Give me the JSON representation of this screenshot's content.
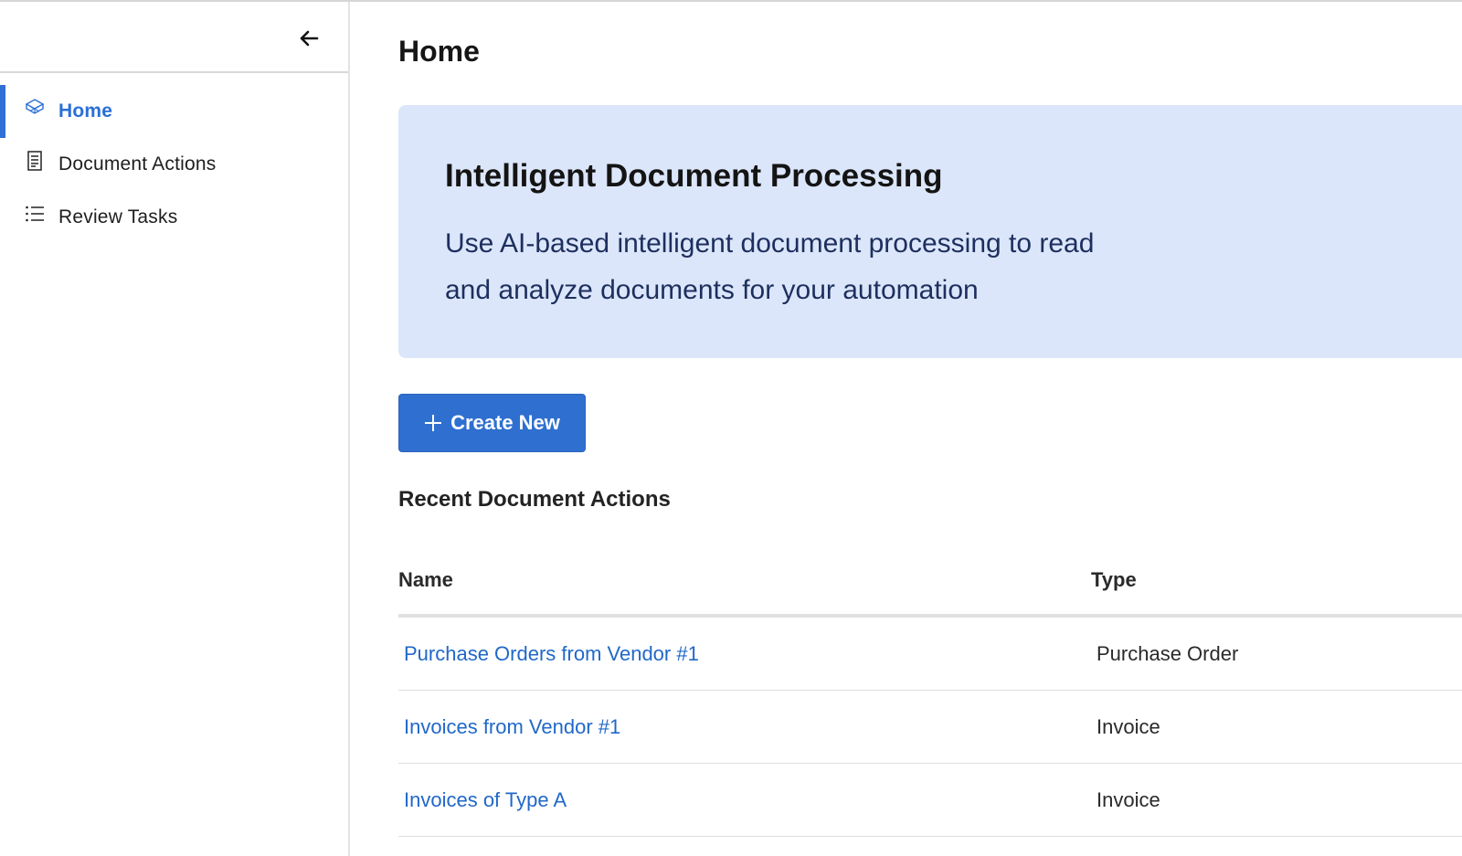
{
  "sidebar": {
    "collapse_icon": "arrow-left-icon",
    "items": [
      {
        "label": "Home",
        "icon": "home-cube-icon",
        "active": true
      },
      {
        "label": "Document Actions",
        "icon": "document-icon",
        "active": false
      },
      {
        "label": "Review Tasks",
        "icon": "list-icon",
        "active": false
      }
    ]
  },
  "main": {
    "title": "Home",
    "hero": {
      "title": "Intelligent Document Processing",
      "description_line1": "Use AI-based intelligent document processing to read",
      "description_line2": "and analyze documents for your automation"
    },
    "create_button": {
      "label": "Create New",
      "icon": "plus-icon"
    },
    "recent_title": "Recent Document Actions",
    "table": {
      "columns": [
        "Name",
        "Type"
      ],
      "rows": [
        {
          "name": "Purchase Orders from Vendor #1",
          "type": "Purchase Order"
        },
        {
          "name": "Invoices from Vendor #1",
          "type": "Invoice"
        },
        {
          "name": "Invoices of Type A",
          "type": "Invoice"
        }
      ]
    }
  },
  "colors": {
    "accent": "#2f6fd0",
    "link": "#2168c8",
    "hero_bg": "#dce6fa",
    "hero_text": "#1d2f5e"
  }
}
